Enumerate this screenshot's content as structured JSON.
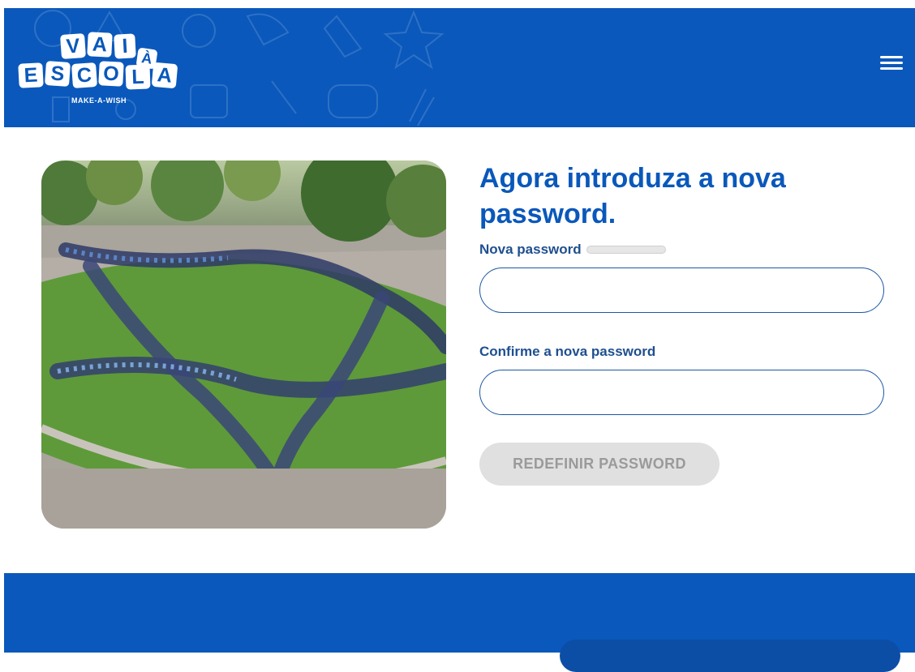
{
  "header": {
    "logo": {
      "row1": [
        "V",
        "A",
        "I",
        "À"
      ],
      "row2": [
        "E",
        "S",
        "C",
        "O",
        "L",
        "A"
      ],
      "subtitle": "MAKE-A-WISH"
    },
    "menu_icon": "hamburger-menu-icon"
  },
  "photo": {
    "description": "group-photo-heart-shape"
  },
  "form": {
    "title": "Agora introduza a nova password.",
    "new_password_label": "Nova password",
    "new_password_value": "",
    "confirm_password_label": "Confirme a nova password",
    "confirm_password_value": "",
    "submit_label": "REDEFINIR PASSWORD"
  },
  "colors": {
    "brand_blue": "#0a58bb",
    "label_blue": "#1f4f8f",
    "button_disabled_bg": "#e0e0e0",
    "button_disabled_text": "#9a9a9a"
  }
}
